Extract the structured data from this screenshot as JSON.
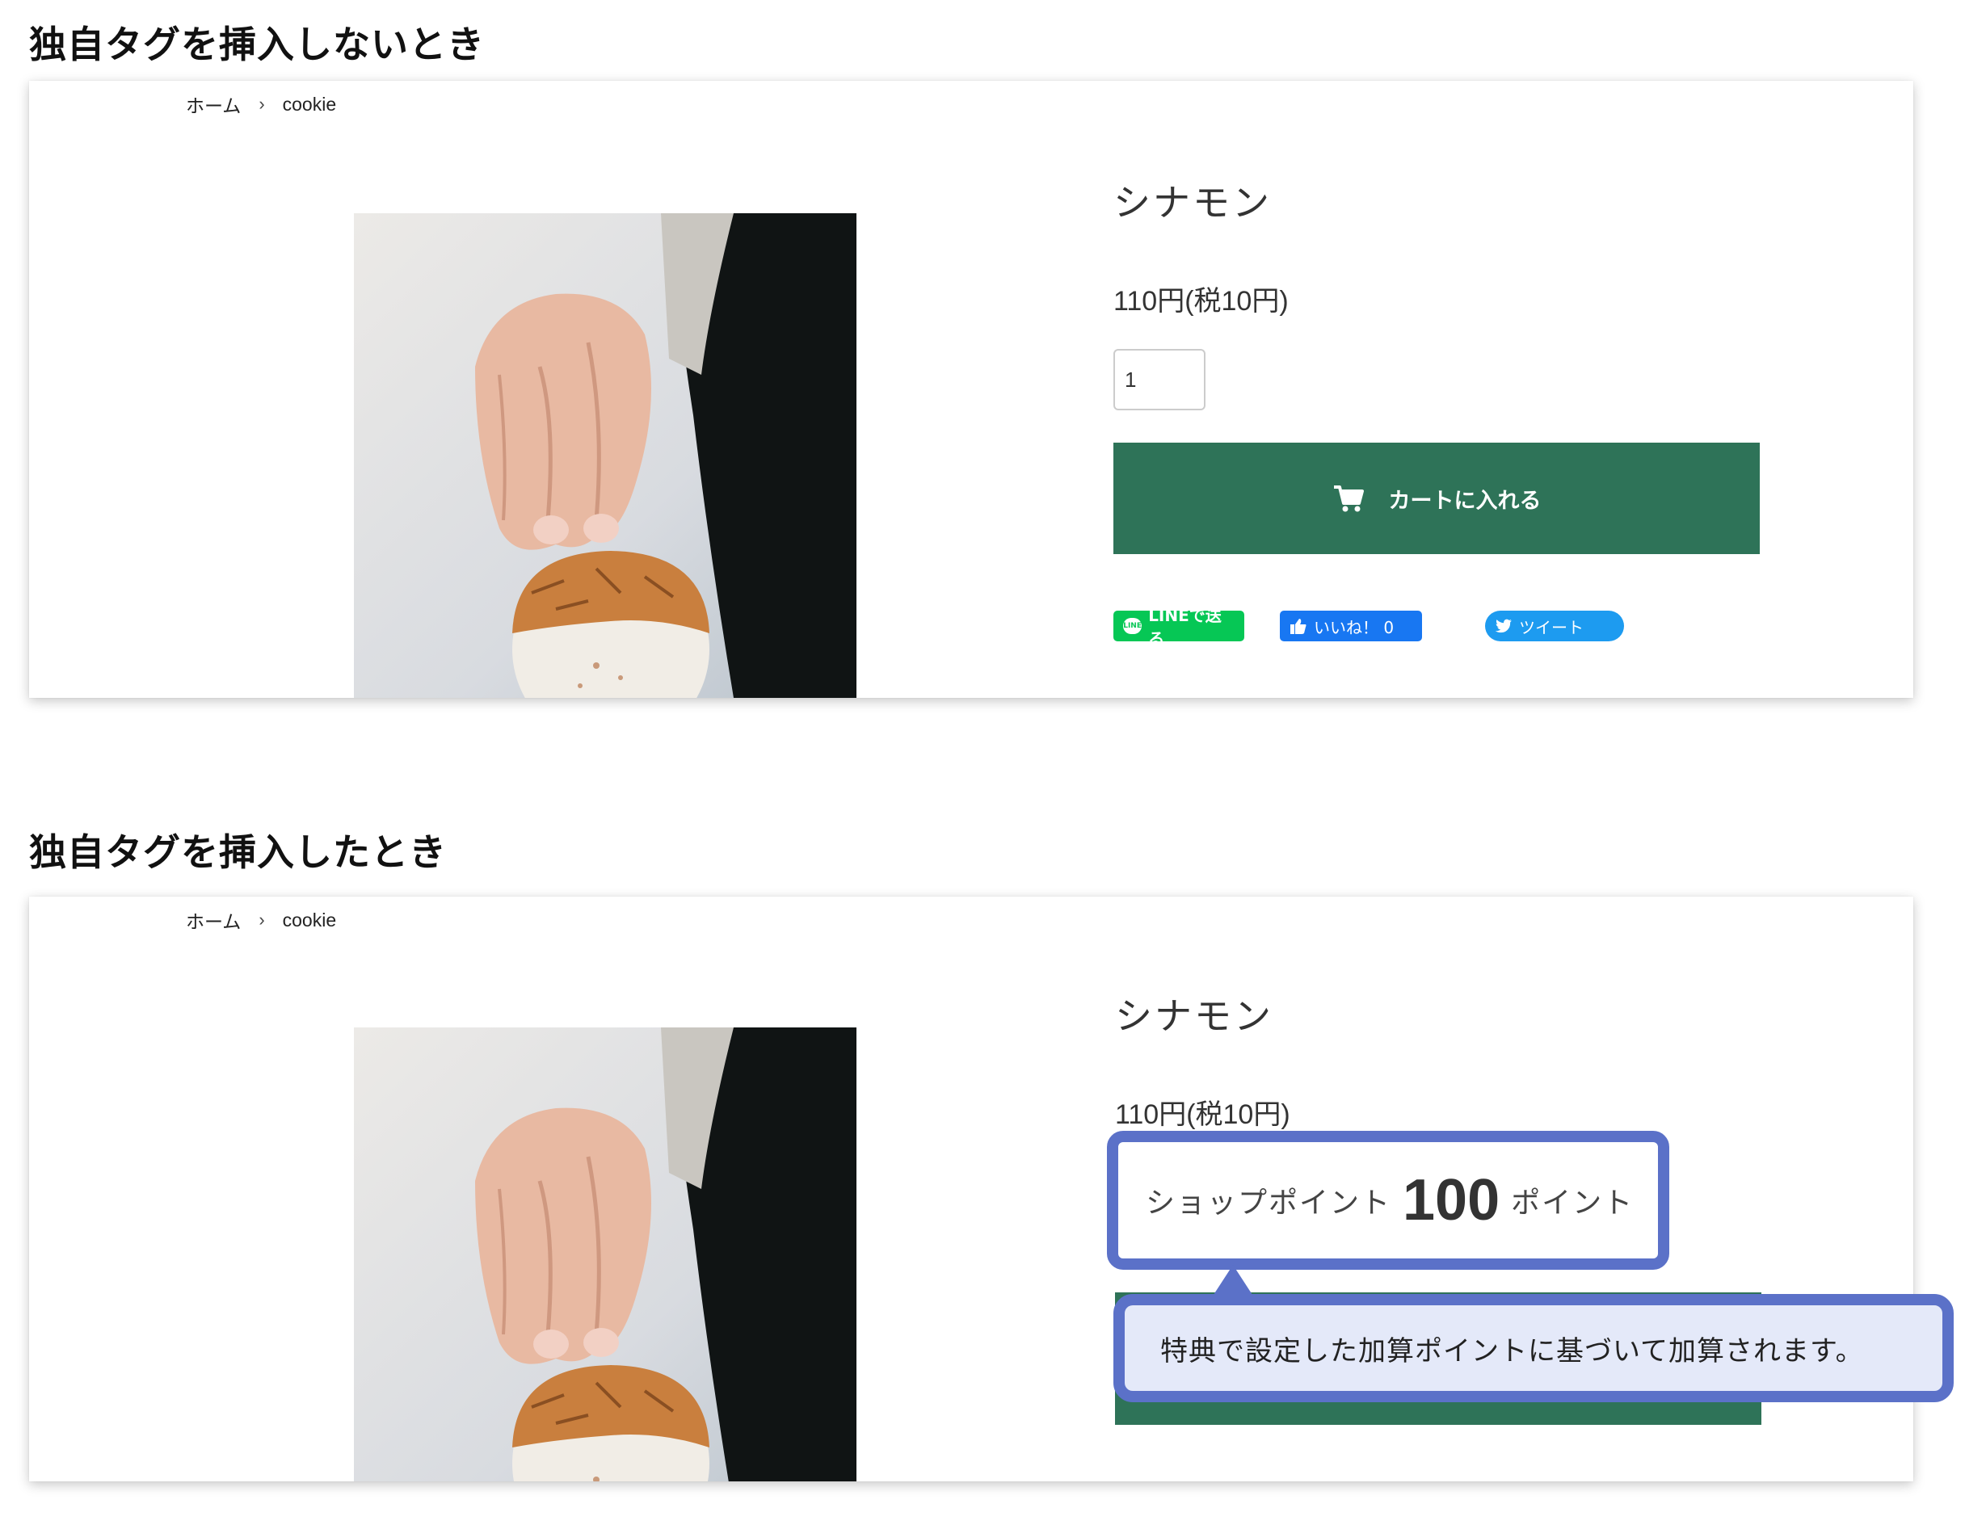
{
  "sections": [
    {
      "title": "独自タグを挿入しないとき",
      "breadcrumb": {
        "home": "ホーム",
        "separator": "›",
        "current": "cookie"
      },
      "product": {
        "name": "シナモン",
        "price": "110円(税10円)",
        "quantity": "1",
        "cart_label": "カートに入れる"
      },
      "share": {
        "line": "LINEで送る",
        "like": "いいね！ 0",
        "tweet": "ツイート"
      }
    },
    {
      "title": "独自タグを挿入したとき",
      "breadcrumb": {
        "home": "ホーム",
        "separator": "›",
        "current": "cookie"
      },
      "product": {
        "name": "シナモン",
        "price": "110円(税10円)"
      },
      "points": {
        "label": "ショップポイント",
        "value": "100",
        "unit": "ポイント"
      },
      "note": "特典で設定した加算ポイントに基づいて加算されます。"
    }
  ],
  "colors": {
    "cart_green": "#2e7358",
    "callout_border": "#5b71c8",
    "callout_fill": "#e4e9f9",
    "line_green": "#06c755",
    "facebook_blue": "#1877f2",
    "twitter_blue": "#1d9bf0"
  },
  "icons": [
    "cart-icon",
    "line-icon",
    "thumbs-up-icon",
    "twitter-bird-icon",
    "chevron-right-icon"
  ]
}
